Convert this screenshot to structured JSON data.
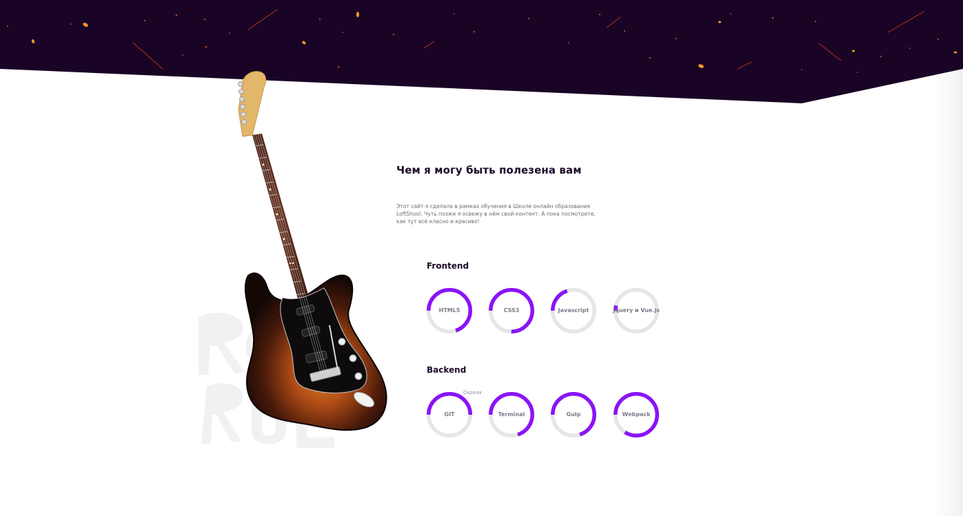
{
  "about": {
    "title": "Чем я могу быть полезена вам",
    "description": "Этот сайт я сделала в рамках обучения в Школе онлайн образования LoftShool. Чуть позже я освежу в нём свой контент. А пока посмотрите, как тут всё класно и красиво!"
  },
  "skills": {
    "frontend": {
      "title": "Frontend",
      "items": [
        {
          "name": "HTML5",
          "percent": 70
        },
        {
          "name": "CSS3",
          "percent": 75
        },
        {
          "name": "Javascript",
          "percent": 20
        },
        {
          "name": "Jquery и Vue.js",
          "percent": 4
        }
      ]
    },
    "backend": {
      "title": "Backend",
      "items": [
        {
          "name": "GIT",
          "percent": 50
        },
        {
          "name": "Terminal",
          "percent": 70
        },
        {
          "name": "Gulp",
          "percent": 70
        },
        {
          "name": "Webpack",
          "percent": 84
        }
      ]
    }
  },
  "tooltip": "Скрала",
  "watermark": "Rock Roll",
  "colors": {
    "accent": "#8a14f5",
    "track": "#e6e6e6",
    "header_bg": "#1a0426",
    "title": "#1b0a2a",
    "skill_label": "#7d7887"
  }
}
